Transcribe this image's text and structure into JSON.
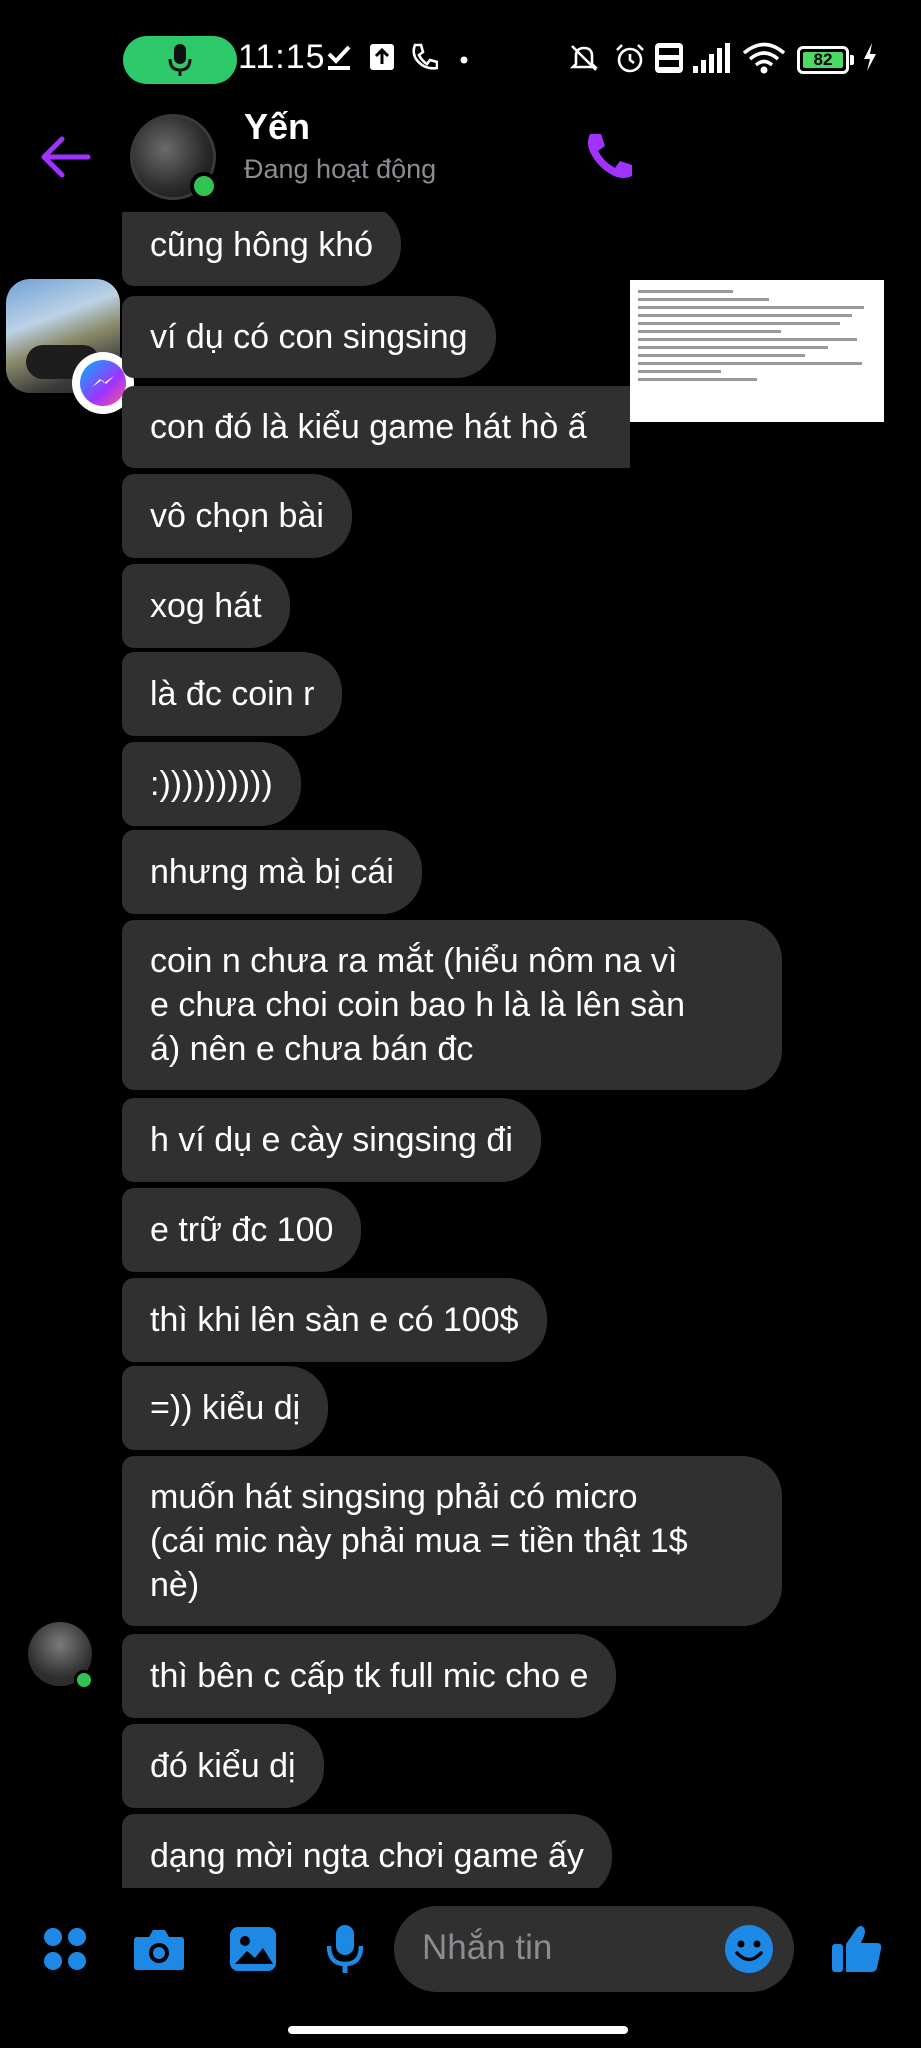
{
  "status_bar": {
    "time": "11:15",
    "battery": "82"
  },
  "header": {
    "name": "Yến",
    "status": "Đang hoạt động"
  },
  "messages": [
    "cũng hông khó",
    "ví dụ có con singsing",
    "con đó là kiểu game hát hò ấ",
    "vô chọn bài",
    "xog hát",
    "là đc coin r",
    ":))))))))))",
    "nhưng mà bị cái",
    "coin n chưa ra mắt (hiểu nôm na vì\ne chưa choi coin bao h là là lên sàn\ná) nên e chưa bán đc",
    "h ví dụ e cày singsing đi",
    "e trữ đc 100",
    "thì khi lên sàn e có 100$",
    "=)) kiểu dị",
    "muốn hát singsing phải có micro\n(cái mic này phải mua = tiền thật 1$\nnè)",
    "thì bên c cấp tk full mic cho e",
    "đó kiểu dị",
    "dạng mời ngta chơi game ấy"
  ],
  "composer": {
    "placeholder": "Nhắn tin"
  },
  "colors": {
    "accent": "#a033ff",
    "blue": "#1e88e5",
    "bubble": "#303030",
    "online": "#31c453"
  }
}
